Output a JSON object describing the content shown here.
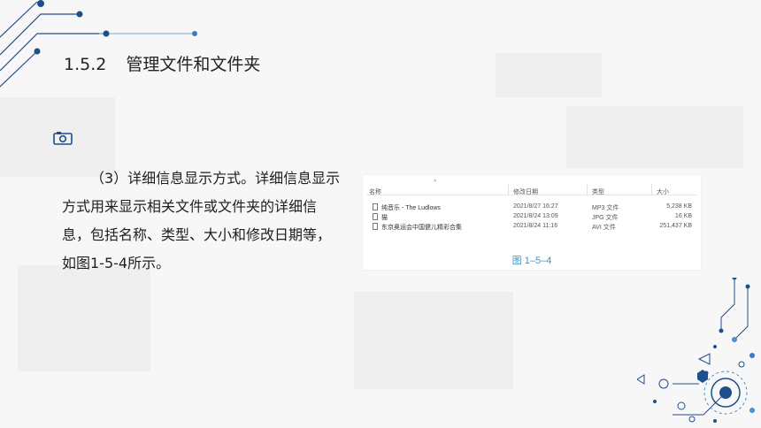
{
  "slide": {
    "section_number": "1.5.2",
    "section_title": "管理文件和文件夹",
    "paragraph": "（3）详细信息显示方式。详细信息显示方式用来显示相关文件或文件夹的详细信息，包括名称、类型、大小和修改日期等，如图1-5-4所示。"
  },
  "figure": {
    "columns": [
      "名称",
      "修改日期",
      "类型",
      "大小"
    ],
    "sort_indicator": "^",
    "rows": [
      {
        "name": "纯音乐 - The Ludlows",
        "date": "2021/8/27 16:27",
        "type": "MP3 文件",
        "size": "5,238 KB"
      },
      {
        "name": "猫",
        "date": "2021/8/24 13:09",
        "type": "JPG 文件",
        "size": "16 KB"
      },
      {
        "name": "东京奥运会中国健儿精彩合集",
        "date": "2021/8/24 11:16",
        "type": "AVI 文件",
        "size": "251,437 KB"
      }
    ],
    "caption": "图 1–5–4"
  },
  "icons": {
    "camera": "camera-icon",
    "file": "file-icon"
  },
  "colors": {
    "accent_blue": "#1f4e8c",
    "caption_blue": "#3d93c9",
    "text": "#222222"
  }
}
